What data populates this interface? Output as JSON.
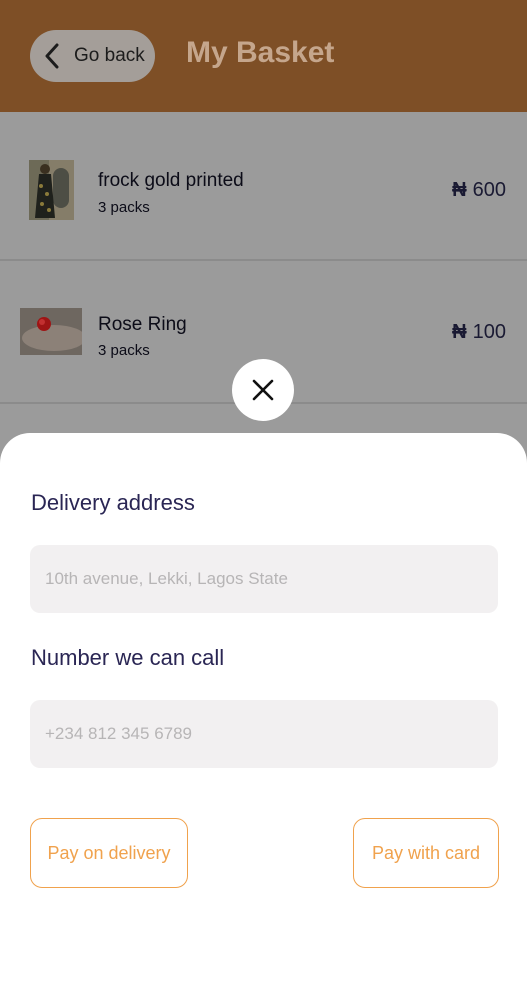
{
  "header": {
    "back_label": "Go back",
    "title": "My Basket"
  },
  "basket": {
    "items": [
      {
        "name": "frock gold printed",
        "qty": "3 packs",
        "currency": "₦",
        "price": "600"
      },
      {
        "name": "Rose Ring",
        "qty": "3 packs",
        "currency": "₦",
        "price": "100"
      }
    ]
  },
  "sheet": {
    "address_label": "Delivery address",
    "address_placeholder": "10th avenue, Lekki, Lagos State",
    "phone_label": "Number we can call",
    "phone_placeholder": "+234 812 345 6789",
    "pay_delivery_label": "Pay on delivery",
    "pay_card_label": "Pay with card"
  },
  "colors": {
    "header_bg": "#7e4f26",
    "accent": "#f0a24d",
    "label_text": "#2a2654",
    "overlay": "#9b9b9b"
  },
  "icons": {
    "back": "chevron-left-icon",
    "close": "close-icon"
  }
}
